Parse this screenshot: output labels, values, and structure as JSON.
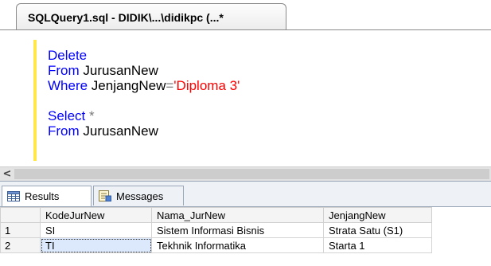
{
  "document_tab": {
    "title": "SQLQuery1.sql - DIDIK\\...\\didikpc (...*"
  },
  "editor": {
    "lines": [
      [
        {
          "text": "Delete",
          "style": "kw"
        }
      ],
      [
        {
          "text": "From ",
          "style": "kw"
        },
        {
          "text": "JurusanNew",
          "style": "id"
        }
      ],
      [
        {
          "text": "Where ",
          "style": "kw"
        },
        {
          "text": "JenjangNew",
          "style": "id"
        },
        {
          "text": "=",
          "style": "op"
        },
        {
          "text": "'Diploma 3'",
          "style": "str"
        }
      ],
      [],
      [
        {
          "text": "Select ",
          "style": "kw"
        },
        {
          "text": "*",
          "style": "op"
        }
      ],
      [
        {
          "text": "From ",
          "style": "kw"
        },
        {
          "text": "JurusanNew",
          "style": "id"
        }
      ]
    ]
  },
  "scrollbar": {
    "left_arrow": "<"
  },
  "results_tabs": {
    "results_label": "Results",
    "messages_label": "Messages",
    "icons": {
      "results": "grid-icon",
      "messages": "messages-icon"
    }
  },
  "grid": {
    "columns": [
      "KodeJurNew",
      "Nama_JurNew",
      "JenjangNew"
    ],
    "rows": [
      {
        "num": "1",
        "cells": [
          "SI",
          "Sistem Informasi Bisnis",
          "Strata Satu (S1)"
        ]
      },
      {
        "num": "2",
        "cells": [
          "TI",
          "Tekhnik Informatika",
          "Starta 1"
        ]
      }
    ],
    "selected_cell": {
      "row": 1,
      "col": 0
    }
  },
  "colors": {
    "keyword": "#0000ff",
    "string": "#ff0000",
    "operator": "#7a7a7a",
    "margin_marker": "#ffe64d"
  }
}
